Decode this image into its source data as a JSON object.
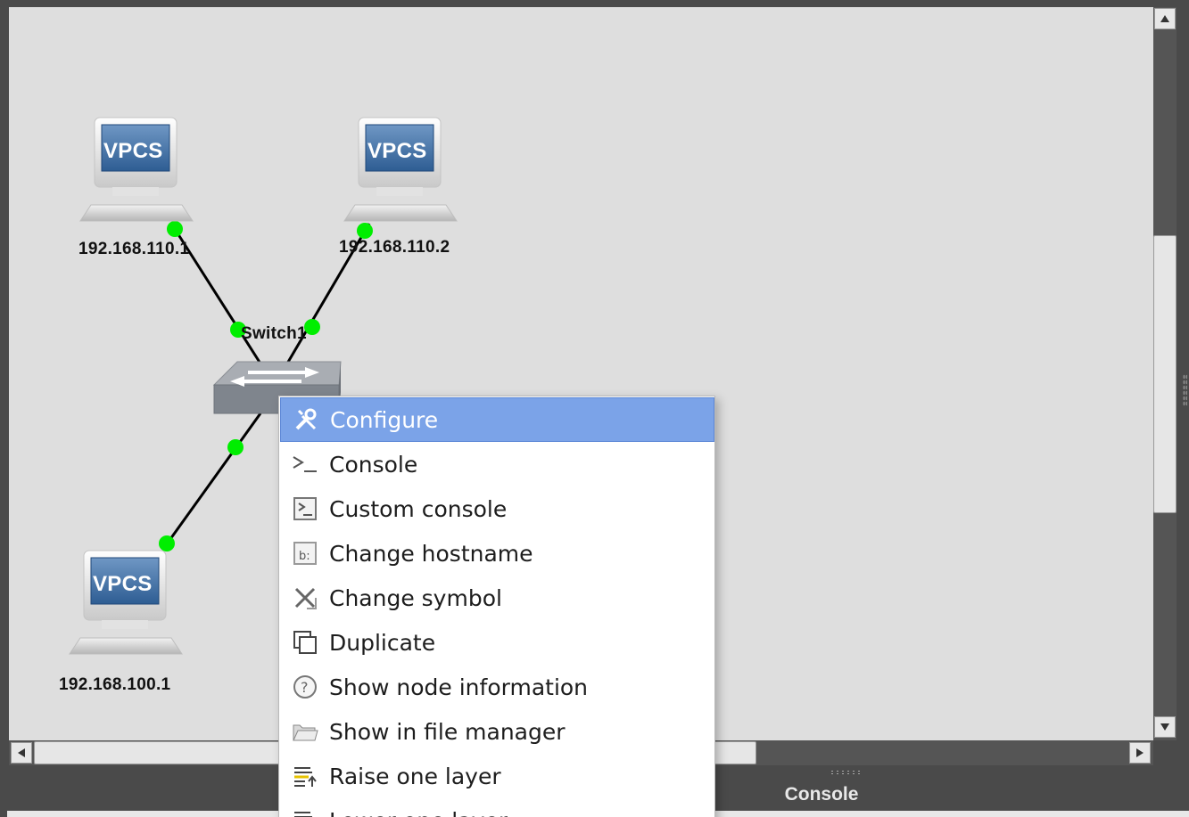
{
  "nodes": {
    "pc1": {
      "icon_text": "VPCS",
      "label": "192.168.110.1"
    },
    "pc2": {
      "icon_text": "VPCS",
      "label": "192.168.110.2"
    },
    "pc3": {
      "icon_text": "VPCS",
      "label": "192.168.100.1"
    },
    "switch": {
      "label": "Switch1"
    }
  },
  "colors": {
    "link_status_up": "#00ee00",
    "menu_highlight": "#7ba3e8",
    "canvas_bg": "#dedede"
  },
  "context_menu": {
    "items": [
      {
        "label": "Configure",
        "icon": "wrench-screwdriver-icon",
        "highlighted": true
      },
      {
        "label": "Console",
        "icon": "terminal-prompt-icon"
      },
      {
        "label": "Custom console",
        "icon": "custom-console-icon"
      },
      {
        "label": "Change hostname",
        "icon": "rename-icon"
      },
      {
        "label": "Change symbol",
        "icon": "symbol-icon"
      },
      {
        "label": "Duplicate",
        "icon": "duplicate-icon"
      },
      {
        "label": "Show node information",
        "icon": "help-circle-icon"
      },
      {
        "label": "Show in file manager",
        "icon": "folder-icon"
      },
      {
        "label": "Raise one layer",
        "icon": "raise-layer-icon"
      },
      {
        "label": "Lower one layer",
        "icon": "lower-layer-icon"
      }
    ]
  },
  "console_dock": {
    "title": "Console"
  }
}
